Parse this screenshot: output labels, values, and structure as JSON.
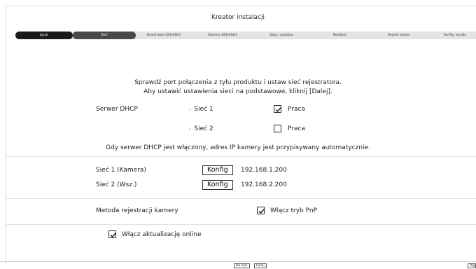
{
  "window": {
    "title": "Kreator instalacji"
  },
  "steps": [
    {
      "label": "Język"
    },
    {
      "label": "Sieć"
    },
    {
      "label": "Rejestrator ID/HASŁO"
    },
    {
      "label": "Kamera ID/HASŁO"
    },
    {
      "label": "Data i godzina"
    },
    {
      "label": "Rozdziel."
    },
    {
      "label": "Rejestr kamer"
    },
    {
      "label": "Konfig. kanału"
    }
  ],
  "intro": {
    "line1": "Sprawdź port połączenia z tyłu produktu i ustaw sieć rejestratora.",
    "line2": "Aby ustawić ustawienia sieci na podstawowe, kliknij [Dalej]."
  },
  "dhcp": {
    "label": "Serwer DHCP",
    "net1": {
      "label": "Sieć 1",
      "option": "Praca",
      "checked": true
    },
    "net2": {
      "label": "Sieć 2",
      "option": "Praca",
      "checked": false
    },
    "note": "Gdy serwer DHCP jest włączony, adres IP kamery jest przypisywany automatycznie."
  },
  "networks": [
    {
      "label": "Sieć 1 (Kamera)",
      "button": "Konfig",
      "ip": "192.168.1.200"
    },
    {
      "label": "Sieć 2 (Wsz.)",
      "button": "Konfig",
      "ip": "192.168.2.200"
    }
  ],
  "registration": {
    "label": "Metoda rejestracji kamery",
    "pnp_label": "Włącz tryb PnP",
    "pnp_checked": true
  },
  "online_update": {
    "label": "Włącz aktualizację online",
    "checked": true
  },
  "footer": {
    "back": "Do tyłu",
    "next": "Dalej",
    "exit": "Wyj"
  }
}
